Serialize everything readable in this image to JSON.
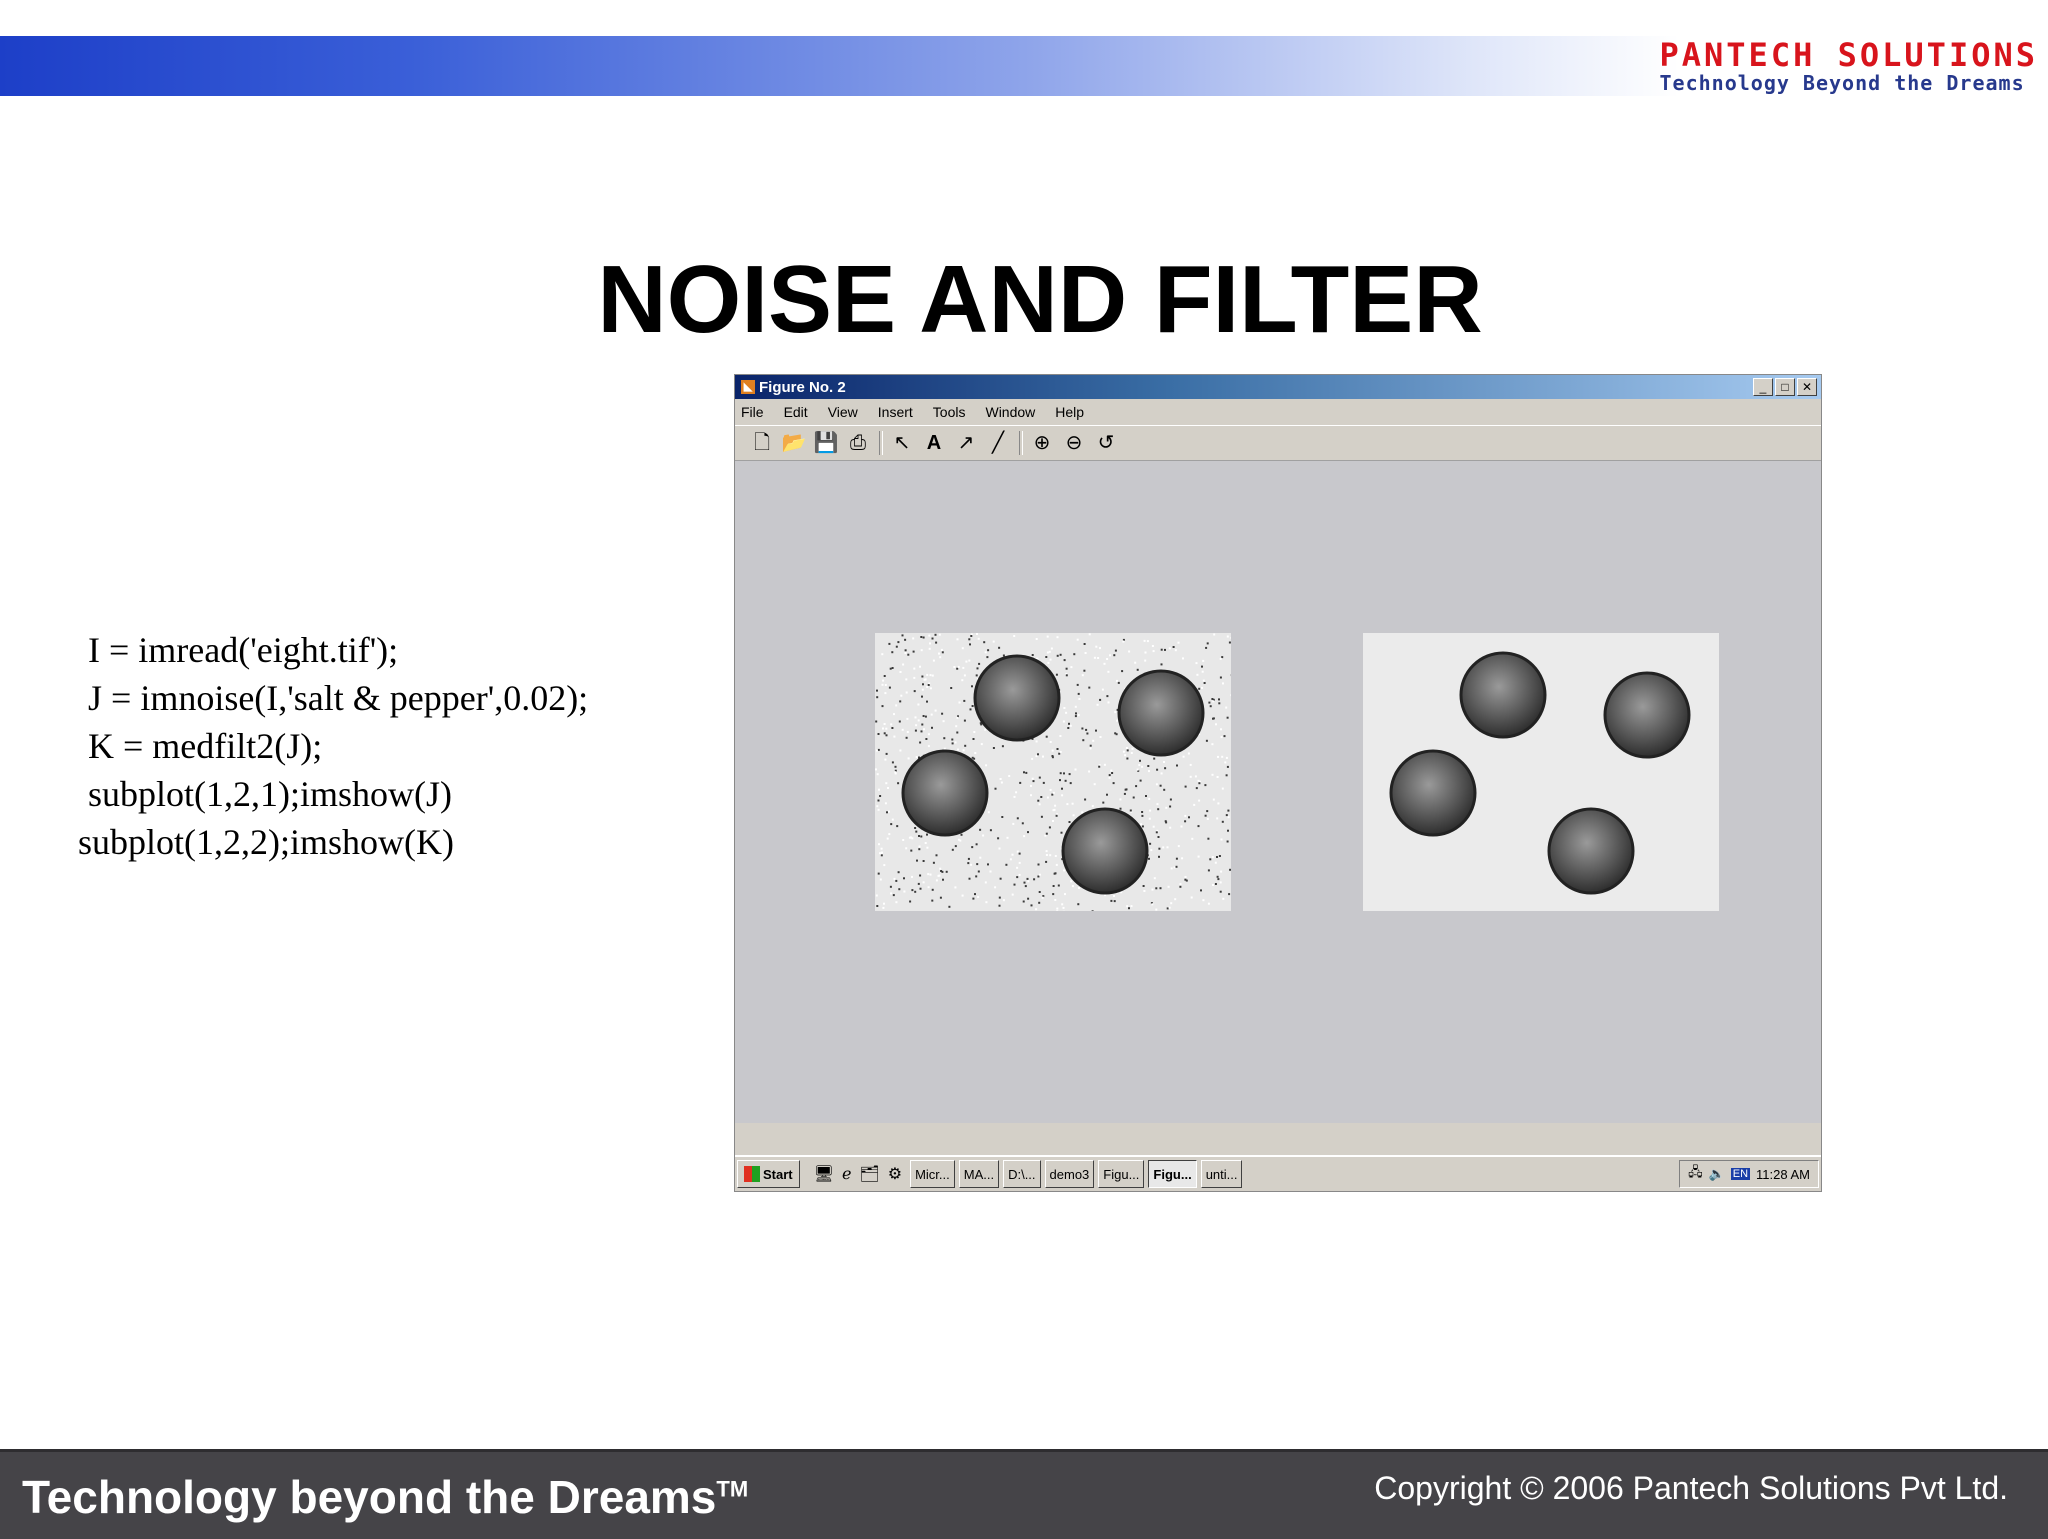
{
  "header": {
    "logo_main": "PANTECH SOLUTIONS",
    "logo_sub": "Technology Beyond the Dreams",
    "brand_color": "#d8141c",
    "band_color": "#1d3fc8"
  },
  "slide": {
    "title": "NOISE AND FILTER",
    "code_lines": [
      "I = imread('eight.tif');",
      "J = imnoise(I,'salt & pepper',0.02);",
      "K = medfilt2(J);",
      "subplot(1,2,1);imshow(J)",
      "subplot(1,2,2);imshow(K)"
    ]
  },
  "window": {
    "title": "Figure No. 2",
    "controls": [
      "_",
      "□",
      "✕"
    ],
    "menu": [
      "File",
      "Edit",
      "View",
      "Insert",
      "Tools",
      "Window",
      "Help"
    ],
    "toolbar_icons": [
      "new-file-icon",
      "open-folder-icon",
      "save-icon",
      "print-icon",
      "pointer-icon",
      "text-tool-icon",
      "arrow-tool-icon",
      "line-tool-icon",
      "zoom-in-icon",
      "zoom-out-icon",
      "rotate-icon"
    ]
  },
  "taskbar": {
    "start_label": "Start",
    "tasks": [
      "Micr...",
      "MA...",
      "D:\\...",
      "demo3",
      "Figu...",
      "Figu...",
      "unti..."
    ],
    "active_task_index": 5,
    "tray_lang": "EN",
    "clock": "11:28 AM"
  },
  "footer": {
    "tagline": "Technology beyond the Dreams",
    "trademark": "TM",
    "copyright": "Copyright © 2006 Pantech Solutions Pvt Ltd."
  }
}
